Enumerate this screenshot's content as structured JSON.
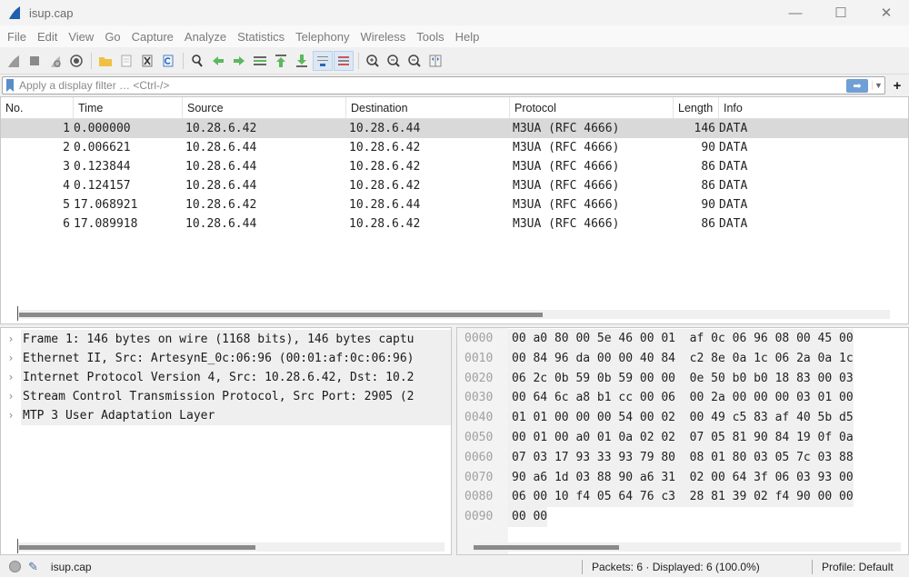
{
  "window": {
    "title": "isup.cap",
    "controls": {
      "minimize": "—",
      "maximize": "☐",
      "close": "✕"
    }
  },
  "menu": [
    "File",
    "Edit",
    "View",
    "Go",
    "Capture",
    "Analyze",
    "Statistics",
    "Telephony",
    "Wireless",
    "Tools",
    "Help"
  ],
  "toolbar": {
    "icons": [
      "shark-fin-start-icon",
      "stop-capture-icon",
      "restart-capture-icon",
      "capture-options-icon",
      "open-file-icon",
      "save-file-icon",
      "close-file-icon",
      "reload-file-icon",
      "find-packet-icon",
      "go-back-icon",
      "go-forward-icon",
      "go-to-packet-icon",
      "go-first-icon",
      "go-last-icon",
      "auto-scroll-icon",
      "colorize-icon",
      "zoom-in-icon",
      "zoom-out-icon",
      "zoom-normal-icon",
      "resize-columns-icon"
    ]
  },
  "filter": {
    "placeholder": "Apply a display filter … <Ctrl-/>",
    "value": "",
    "apply_icon": "arrow-right-icon",
    "plus_label": "+"
  },
  "packet_list": {
    "columns": [
      "No.",
      "Time",
      "Source",
      "Destination",
      "Protocol",
      "Length",
      "Info"
    ],
    "selected_index": 0,
    "rows": [
      {
        "no": "1",
        "time": "0.000000",
        "src": "10.28.6.42",
        "dst": "10.28.6.44",
        "proto": "M3UA (RFC 4666)",
        "len": "146",
        "info": "DATA"
      },
      {
        "no": "2",
        "time": "0.006621",
        "src": "10.28.6.44",
        "dst": "10.28.6.42",
        "proto": "M3UA (RFC 4666)",
        "len": "90",
        "info": "DATA"
      },
      {
        "no": "3",
        "time": "0.123844",
        "src": "10.28.6.44",
        "dst": "10.28.6.42",
        "proto": "M3UA (RFC 4666)",
        "len": "86",
        "info": "DATA"
      },
      {
        "no": "4",
        "time": "0.124157",
        "src": "10.28.6.44",
        "dst": "10.28.6.42",
        "proto": "M3UA (RFC 4666)",
        "len": "86",
        "info": "DATA"
      },
      {
        "no": "5",
        "time": "17.068921",
        "src": "10.28.6.42",
        "dst": "10.28.6.44",
        "proto": "M3UA (RFC 4666)",
        "len": "90",
        "info": "DATA"
      },
      {
        "no": "6",
        "time": "17.089918",
        "src": "10.28.6.44",
        "dst": "10.28.6.42",
        "proto": "M3UA (RFC 4666)",
        "len": "86",
        "info": "DATA"
      }
    ]
  },
  "details": [
    "Frame 1: 146 bytes on wire (1168 bits), 146 bytes captu",
    "Ethernet II, Src: ArtesynE_0c:06:96 (00:01:af:0c:06:96)",
    "Internet Protocol Version 4, Src: 10.28.6.42, Dst: 10.2",
    "Stream Control Transmission Protocol, Src Port: 2905 (2",
    "MTP 3 User Adaptation Layer"
  ],
  "bytes": [
    {
      "offset": "0000",
      "hex": "00 a0 80 00 5e 46 00 01  af 0c 06 96 08 00 45 00"
    },
    {
      "offset": "0010",
      "hex": "00 84 96 da 00 00 40 84  c2 8e 0a 1c 06 2a 0a 1c"
    },
    {
      "offset": "0020",
      "hex": "06 2c 0b 59 0b 59 00 00  0e 50 b0 b0 18 83 00 03"
    },
    {
      "offset": "0030",
      "hex": "00 64 6c a8 b1 cc 00 06  00 2a 00 00 00 03 01 00"
    },
    {
      "offset": "0040",
      "hex": "01 01 00 00 00 54 00 02  00 49 c5 83 af 40 5b d5"
    },
    {
      "offset": "0050",
      "hex": "00 01 00 a0 01 0a 02 02  07 05 81 90 84 19 0f 0a"
    },
    {
      "offset": "0060",
      "hex": "07 03 17 93 33 93 79 80  08 01 80 03 05 7c 03 88"
    },
    {
      "offset": "0070",
      "hex": "90 a6 1d 03 88 90 a6 31  02 00 64 3f 06 03 93 00"
    },
    {
      "offset": "0080",
      "hex": "06 00 10 f4 05 64 76 c3  28 81 39 02 f4 90 00 00"
    },
    {
      "offset": "0090",
      "hex": "00 00"
    }
  ],
  "status": {
    "file": "isup.cap",
    "packets": "Packets: 6 · Displayed: 6 (100.0%)",
    "profile": "Profile: Default"
  }
}
